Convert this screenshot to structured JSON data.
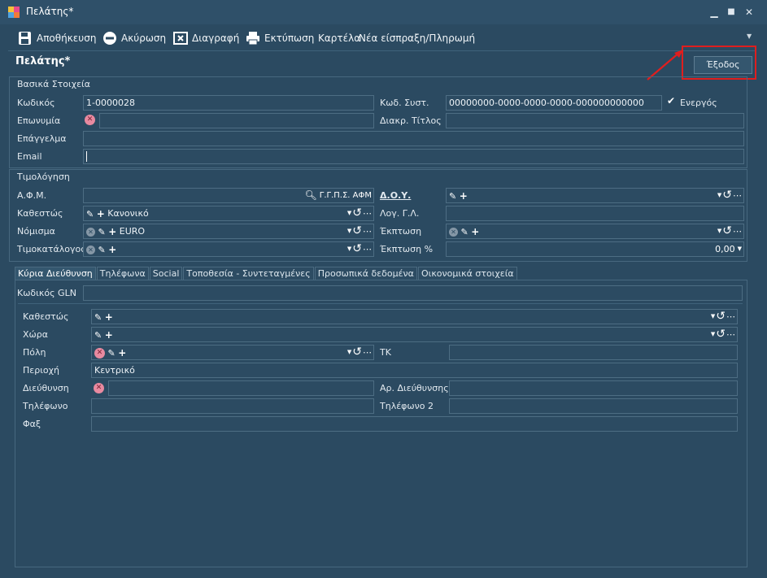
{
  "window": {
    "title": "Πελάτης*"
  },
  "toolbar": {
    "save": "Αποθήκευση",
    "cancel": "Ακύρωση",
    "delete": "Διαγραφή",
    "print": "Εκτύπωση",
    "card": "Καρτέλα",
    "receipt": "Νέα είσπραξη/Πληρωμή"
  },
  "header": {
    "title": "Πελάτης*",
    "exit_label": "Έξοδος"
  },
  "basic": {
    "section": "Βασικά Στοιχεία",
    "code_label": "Κωδικός",
    "code_value": "1-0000028",
    "syscode_label": "Κωδ. Συστ.",
    "syscode_value": "00000000-0000-0000-0000-000000000000",
    "active_label": "Ενεργός",
    "surname_label": "Επωνυμία",
    "surname_value": "",
    "title_label": "Διακρ. Τίτλος",
    "title_value": "",
    "profession_label": "Επάγγελμα",
    "profession_value": "",
    "email_label": "Email",
    "email_value": ""
  },
  "billing": {
    "section": "Τιμολόγηση",
    "afm_label": "Α.Φ.Μ.",
    "afm_search": "Γ.Γ.Π.Σ. ΑΦΜ",
    "doy_label": "Δ.Ο.Υ.",
    "status_label": "Καθεστώς",
    "status_value": "Κανονικό",
    "ledger_label": "Λογ. Γ.Λ.",
    "currency_label": "Νόμισμα",
    "currency_value": "EURO",
    "discount_label": "Έκπτωση",
    "pricelist_label": "Τιμοκατάλογος",
    "discount_pct_label": "Έκπτωση %",
    "discount_pct_value": "0,00"
  },
  "tabs": [
    "Κύρια Διεύθυνση",
    "Τηλέφωνα",
    "Social",
    "Τοποθεσία - Συντεταγμένες",
    "Προσωπικά δεδομένα",
    "Οικονομικά στοιχεία"
  ],
  "address": {
    "gln_label": "Κωδικός GLN",
    "status_label": "Καθεστώς",
    "country_label": "Χώρα",
    "city_label": "Πόλη",
    "tk_label": "ΤΚ",
    "area_label": "Περιοχή",
    "area_value": "Κεντρικό",
    "street_label": "Διεύθυνση",
    "number_label": "Αρ. Διεύθυνσης",
    "phone_label": "Τηλέφωνο",
    "phone2_label": "Τηλέφωνο 2",
    "fax_label": "Φαξ"
  }
}
